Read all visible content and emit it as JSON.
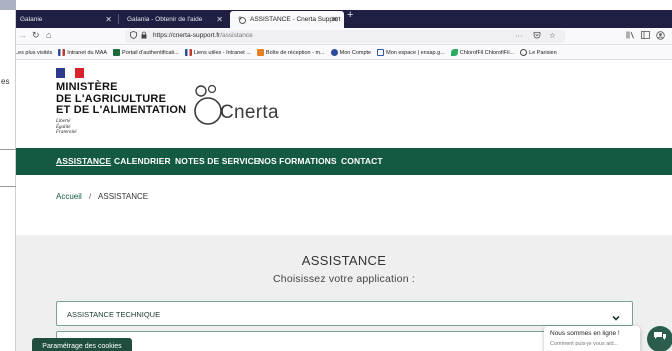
{
  "ghost": {
    "text": "es"
  },
  "browser": {
    "tabs": [
      {
        "label": "Galanie"
      },
      {
        "label": "Galania - Obtenir de l'aide"
      },
      {
        "label": "ASSISTANCE - Cnerta Support"
      }
    ],
    "url_host": "https://cnerta-support.fr",
    "url_path": "/assistance",
    "bookmarks": [
      {
        "label": "Les plus visités",
        "color": "#666666"
      },
      {
        "label": "Intranet du MAA",
        "color": "#c0392b"
      },
      {
        "label": "Portail d'authentificati...",
        "color": "#1e6b3a"
      },
      {
        "label": "Liens utiles - Intranet ...",
        "color": "#2e5aa8"
      },
      {
        "label": "Boîte de réception - m...",
        "color": "#e67e22"
      },
      {
        "label": "Mon Compte",
        "color": "#2e4a9a"
      },
      {
        "label": "Mon espace | ensap.g...",
        "color": "#2e5aa8"
      },
      {
        "label": "ChlorofFil ChlorofiFil...",
        "color": "#27ae60"
      },
      {
        "label": "Le Parisien",
        "color": "#444444"
      }
    ]
  },
  "site": {
    "ministry_lines": [
      "MINISTÈRE",
      "DE L'AGRICULTURE",
      "ET DE L'ALIMENTATION"
    ],
    "devise": [
      "Liberté",
      "Égalité",
      "Fraternité"
    ],
    "brand": "Cnerta",
    "nav": [
      "ASSISTANCE",
      "CALENDRIER",
      "NOTES DE SERVICE",
      "NOS FORMATIONS",
      "CONTACT"
    ],
    "breadcrumb": {
      "home": "Accueil",
      "sep": "/",
      "current": "ASSISTANCE"
    },
    "section": {
      "title": "ASSISTANCE",
      "subtitle": "Choisissez votre application :",
      "select_label": "ASSISTANCE TECHNIQUE"
    },
    "cookie_button": "Paramétrage des cookies",
    "chat": {
      "title": "Nous sommes en ligne !",
      "subtitle": "Comment puis-je vous aid..."
    }
  },
  "colors": {
    "nav_green": "#145a43",
    "tabbar": "#1f1f44",
    "section_bg": "#efefef"
  }
}
